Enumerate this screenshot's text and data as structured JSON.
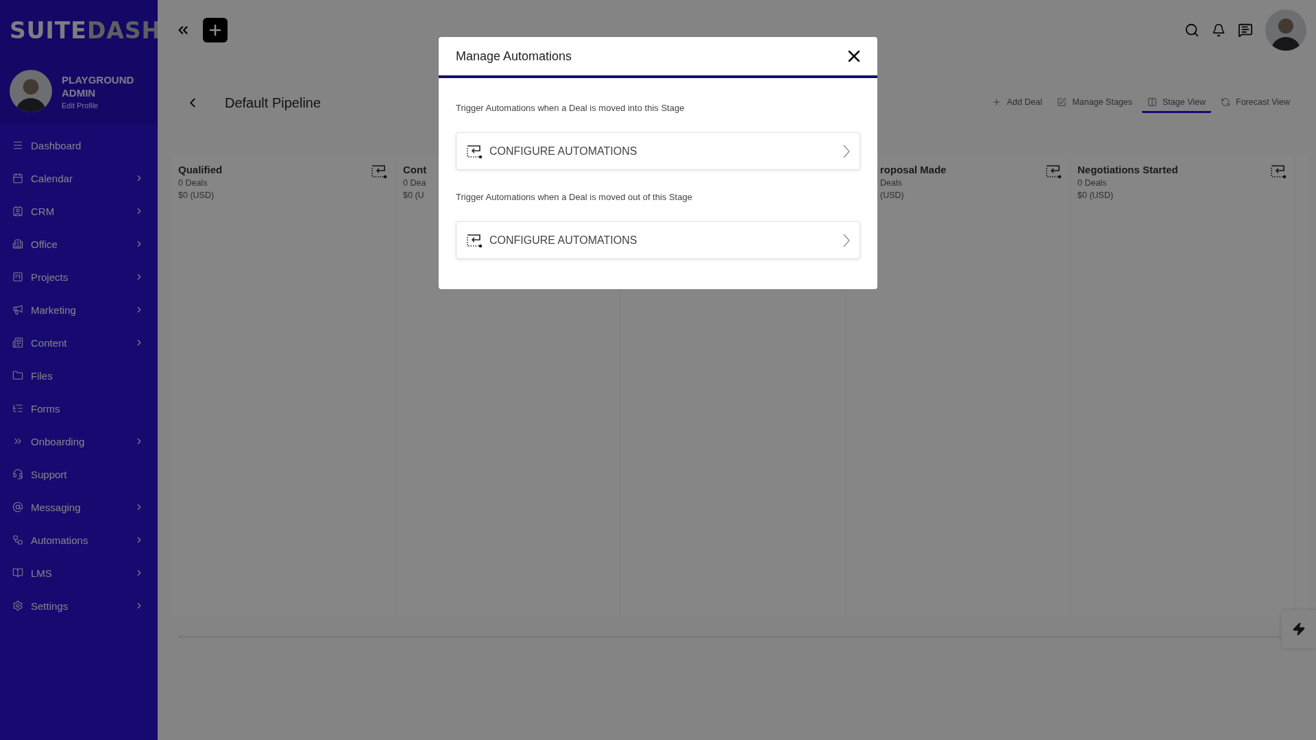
{
  "logo": {
    "light": "SUITE",
    "dark": "DASH"
  },
  "profile": {
    "name": "PLAYGROUND ADMIN",
    "link": "Edit Profile"
  },
  "sidebar": {
    "items": [
      {
        "label": "Dashboard",
        "expandable": false
      },
      {
        "label": "Calendar",
        "expandable": true
      },
      {
        "label": "CRM",
        "expandable": true
      },
      {
        "label": "Office",
        "expandable": true
      },
      {
        "label": "Projects",
        "expandable": true
      },
      {
        "label": "Marketing",
        "expandable": true
      },
      {
        "label": "Content",
        "expandable": true
      },
      {
        "label": "Files",
        "expandable": false
      },
      {
        "label": "Forms",
        "expandable": false
      },
      {
        "label": "Onboarding",
        "expandable": true
      },
      {
        "label": "Support",
        "expandable": false
      },
      {
        "label": "Messaging",
        "expandable": true
      },
      {
        "label": "Automations",
        "expandable": true
      },
      {
        "label": "LMS",
        "expandable": true
      },
      {
        "label": "Settings",
        "expandable": true
      }
    ]
  },
  "page": {
    "title": "Default Pipeline",
    "toolbar": [
      {
        "label": "Add Deal",
        "selected": false
      },
      {
        "label": "Manage Stages",
        "selected": false
      },
      {
        "label": "Stage View",
        "selected": true
      },
      {
        "label": "Forecast View",
        "selected": false
      }
    ],
    "stages": [
      {
        "kind": "full",
        "title": "Qualified",
        "deals": "0 Deals",
        "amount": "$0 (USD)"
      },
      {
        "kind": "cut_right",
        "title": "Cont",
        "deals": "0 Dea",
        "amount": "$0 (U"
      },
      {
        "kind": "cut_left",
        "title": "roposal Made",
        "deals": "Deals",
        "amount": "(USD)"
      },
      {
        "kind": "full",
        "title": "Negotiations Started",
        "deals": "0 Deals",
        "amount": "$0 (USD)"
      }
    ]
  },
  "modal": {
    "title": "Manage Automations",
    "sections": [
      {
        "text": "Trigger Automations when a Deal is moved into this Stage",
        "button": "CONFIGURE AUTOMATIONS"
      },
      {
        "text": "Trigger Automations when a Deal is moved out of this Stage",
        "button": "CONFIGURE AUTOMATIONS"
      }
    ]
  }
}
